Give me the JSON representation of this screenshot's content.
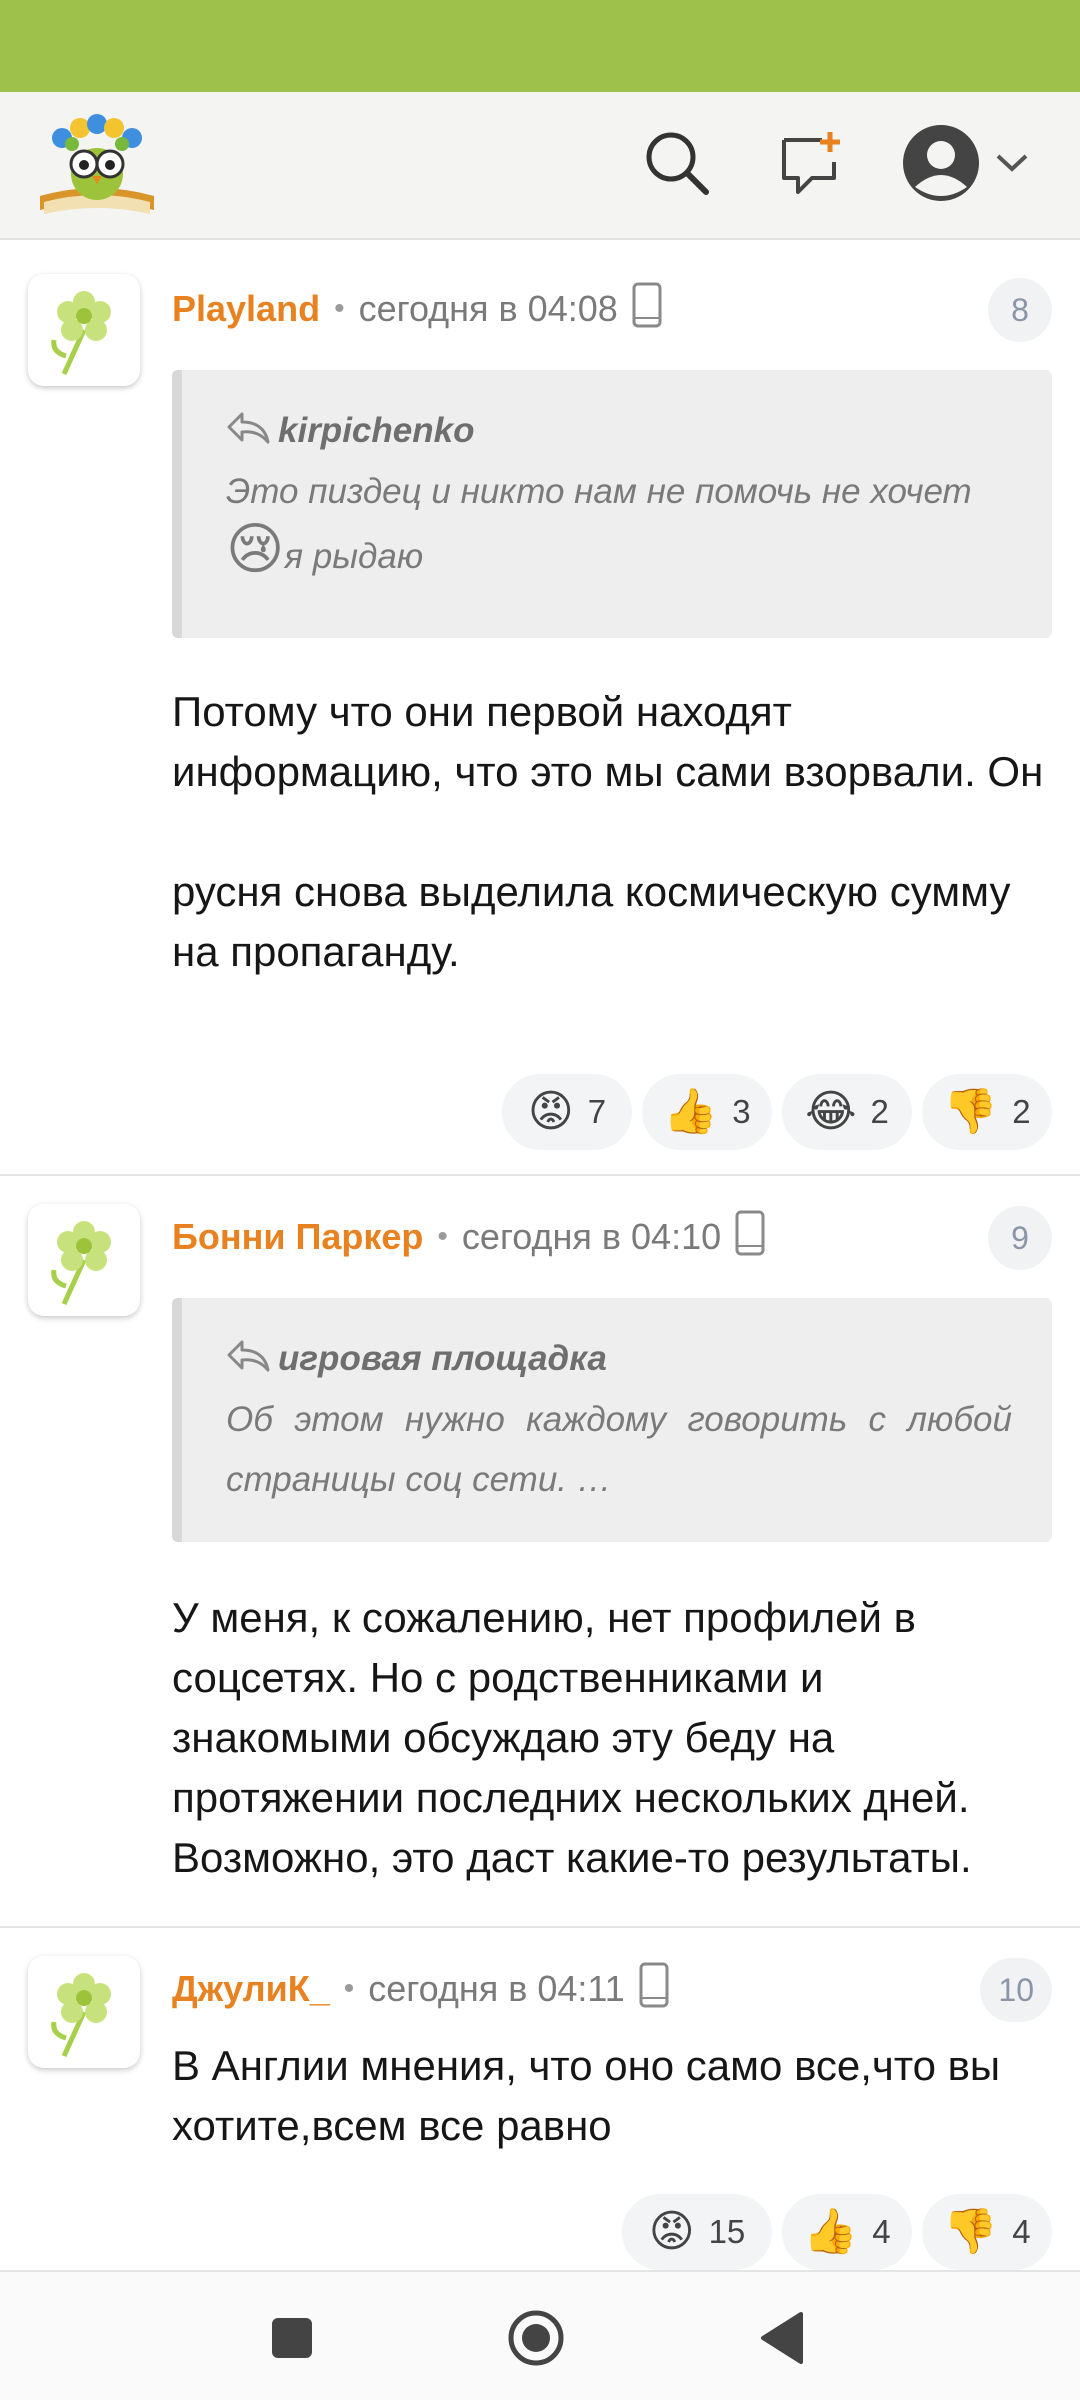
{
  "app": {
    "logo_icon": "owl-on-book-logo",
    "colors": {
      "status_bar": "#9dc14a",
      "author": "#e8811f",
      "header_bg": "#f4f4f2"
    }
  },
  "header": {
    "search_icon": "search-icon",
    "new_post_icon": "new-post-icon",
    "profile_icon": "profile-avatar-icon"
  },
  "comments": [
    {
      "author": "Playland",
      "separator": "•",
      "time": "сегодня в 04:08",
      "device_icon": "mobile-device-icon",
      "number": "8",
      "quote": {
        "author": "kirpichenko",
        "text": "Это пиздец и никто нам не помочь не хочет",
        "emoji": "😢",
        "text2": "я рыдаю"
      },
      "body": "Потому что они первой находят информацию, что это мы сами взорвали. Он\n\nрусня снова выделила космическую сумму на пропаганду.",
      "reactions": [
        {
          "emoji": "😡",
          "count": "7"
        },
        {
          "emoji": "👍",
          "count": "3"
        },
        {
          "emoji": "😂",
          "count": "2"
        },
        {
          "emoji": "👎",
          "count": "2"
        }
      ]
    },
    {
      "author": "Бонни Паркер",
      "separator": "•",
      "time": "сегодня в 04:10",
      "device_icon": "mobile-device-icon",
      "number": "9",
      "quote": {
        "author": "игровая площадка",
        "text": "Об этом нужно каждому говорить с любой страницы соц сети.          …"
      },
      "body": "У меня, к сожалению, нет профилей в соцсетях. Но с родственниками и знакомыми обсуждаю эту беду на протяжении последних нескольких дней. Возможно, это даст какие-то результаты."
    },
    {
      "author": "ДжулиК_",
      "separator": "•",
      "time": "сегодня в 04:11",
      "device_icon": "mobile-device-icon",
      "number": "10",
      "body": "В Англии мнения, что оно само все,что вы хотите,всем все равно",
      "reactions": [
        {
          "emoji": "😡",
          "count": "15"
        },
        {
          "emoji": "👍",
          "count": "4"
        },
        {
          "emoji": "👎",
          "count": "4"
        }
      ]
    }
  ],
  "nav": {
    "recents_icon": "recents-square-icon",
    "home_icon": "home-circle-icon",
    "back_icon": "back-triangle-icon"
  }
}
